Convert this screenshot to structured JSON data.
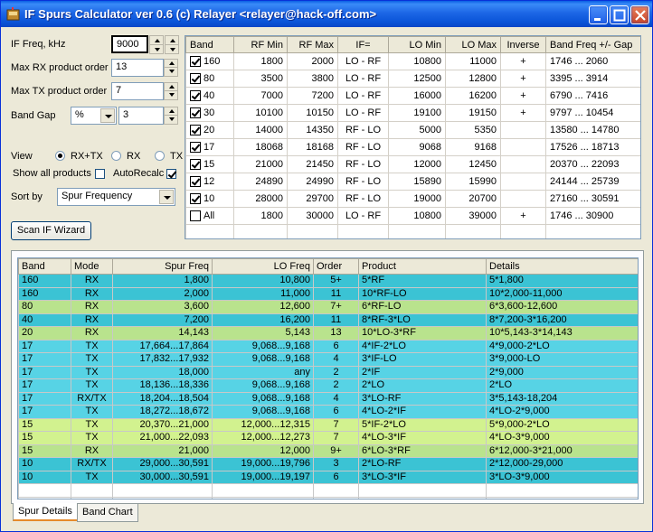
{
  "window": {
    "title": "IF Spurs Calculator ver 0.6 (c) Relayer <relayer@hack-off.com>"
  },
  "form": {
    "if_freq_label": "IF Freq, kHz",
    "if_freq_value": "9000",
    "max_rx_label": "Max RX product order",
    "max_rx_value": "13",
    "max_tx_label": "Max TX product order",
    "max_tx_value": "7",
    "band_gap_label": "Band Gap",
    "band_gap_unit": "%",
    "band_gap_value": "3",
    "view_label": "View",
    "view_options": [
      "RX+TX",
      "RX",
      "TX"
    ],
    "view_selected": "RX+TX",
    "show_all_label": "Show all products",
    "autorecalc_label": "AutoRecalc",
    "show_all_checked": false,
    "autorecalc_checked": true,
    "sort_label": "Sort by",
    "sort_value": "Spur Frequency",
    "scan_button": "Scan IF Wizard"
  },
  "band_table": {
    "headers": [
      "Band",
      "RF Min",
      "RF Max",
      "IF=",
      "LO Min",
      "LO Max",
      "Inverse",
      "Band Freq +/- Gap"
    ],
    "rows": [
      {
        "checked": true,
        "band": "160",
        "rf_min": "1800",
        "rf_max": "2000",
        "if": "LO - RF",
        "lo_min": "10800",
        "lo_max": "11000",
        "inverse": "+",
        "gap": "1746 ... 2060"
      },
      {
        "checked": true,
        "band": "80",
        "rf_min": "3500",
        "rf_max": "3800",
        "if": "LO - RF",
        "lo_min": "12500",
        "lo_max": "12800",
        "inverse": "+",
        "gap": "3395 ... 3914"
      },
      {
        "checked": true,
        "band": "40",
        "rf_min": "7000",
        "rf_max": "7200",
        "if": "LO - RF",
        "lo_min": "16000",
        "lo_max": "16200",
        "inverse": "+",
        "gap": "6790 ... 7416"
      },
      {
        "checked": true,
        "band": "30",
        "rf_min": "10100",
        "rf_max": "10150",
        "if": "LO - RF",
        "lo_min": "19100",
        "lo_max": "19150",
        "inverse": "+",
        "gap": "9797 ... 10454"
      },
      {
        "checked": true,
        "band": "20",
        "rf_min": "14000",
        "rf_max": "14350",
        "if": "RF - LO",
        "lo_min": "5000",
        "lo_max": "5350",
        "inverse": "",
        "gap": "13580 ... 14780"
      },
      {
        "checked": true,
        "band": "17",
        "rf_min": "18068",
        "rf_max": "18168",
        "if": "RF - LO",
        "lo_min": "9068",
        "lo_max": "9168",
        "inverse": "",
        "gap": "17526 ... 18713"
      },
      {
        "checked": true,
        "band": "15",
        "rf_min": "21000",
        "rf_max": "21450",
        "if": "RF - LO",
        "lo_min": "12000",
        "lo_max": "12450",
        "inverse": "",
        "gap": "20370 ... 22093"
      },
      {
        "checked": true,
        "band": "12",
        "rf_min": "24890",
        "rf_max": "24990",
        "if": "RF - LO",
        "lo_min": "15890",
        "lo_max": "15990",
        "inverse": "",
        "gap": "24144 ... 25739"
      },
      {
        "checked": true,
        "band": "10",
        "rf_min": "28000",
        "rf_max": "29700",
        "if": "RF - LO",
        "lo_min": "19000",
        "lo_max": "20700",
        "inverse": "",
        "gap": "27160 ... 30591"
      },
      {
        "checked": false,
        "band": "All",
        "rf_min": "1800",
        "rf_max": "30000",
        "if": "LO - RF",
        "lo_min": "10800",
        "lo_max": "39000",
        "inverse": "+",
        "gap": "1746 ... 30900"
      }
    ]
  },
  "spur_table": {
    "headers": [
      "Band",
      "Mode",
      "Spur Freq",
      "LO Freq",
      "Order",
      "Product",
      "Details"
    ],
    "rows": [
      {
        "color": "#3bc3d4",
        "band": "160",
        "mode": "RX",
        "spur": "1,800",
        "lo": "10,800",
        "order": "5+",
        "product": "5*RF",
        "details": "5*1,800"
      },
      {
        "color": "#3bc3d4",
        "band": "160",
        "mode": "RX",
        "spur": "2,000",
        "lo": "11,000",
        "order": "11",
        "product": "10*RF-LO",
        "details": "10*2,000-11,000"
      },
      {
        "color": "#b9e38d",
        "band": "80",
        "mode": "RX",
        "spur": "3,600",
        "lo": "12,600",
        "order": "7+",
        "product": "6*RF-LO",
        "details": "6*3,600-12,600"
      },
      {
        "color": "#3bc3d4",
        "band": "40",
        "mode": "RX",
        "spur": "7,200",
        "lo": "16,200",
        "order": "11",
        "product": "8*RF-3*LO",
        "details": "8*7,200-3*16,200"
      },
      {
        "color": "#b9e38d",
        "band": "20",
        "mode": "RX",
        "spur": "14,143",
        "lo": "5,143",
        "order": "13",
        "product": "10*LO-3*RF",
        "details": "10*5,143-3*14,143"
      },
      {
        "color": "#57d3e5",
        "band": "17",
        "mode": "TX",
        "spur": "17,664...17,864",
        "lo": "9,068...9,168",
        "order": "6",
        "product": "4*IF-2*LO",
        "details": "4*9,000-2*LO"
      },
      {
        "color": "#57d3e5",
        "band": "17",
        "mode": "TX",
        "spur": "17,832...17,932",
        "lo": "9,068...9,168",
        "order": "4",
        "product": "3*IF-LO",
        "details": "3*9,000-LO"
      },
      {
        "color": "#57d3e5",
        "band": "17",
        "mode": "TX",
        "spur": "18,000",
        "lo": "any",
        "order": "2",
        "product": "2*IF",
        "details": "2*9,000"
      },
      {
        "color": "#57d3e5",
        "band": "17",
        "mode": "TX",
        "spur": "18,136...18,336",
        "lo": "9,068...9,168",
        "order": "2",
        "product": "2*LO",
        "details": "2*LO"
      },
      {
        "color": "#57d3e5",
        "band": "17",
        "mode": "RX/TX",
        "spur": "18,204...18,504",
        "lo": "9,068...9,168",
        "order": "4",
        "product": "3*LO-RF",
        "details": "3*5,143-18,204"
      },
      {
        "color": "#57d3e5",
        "band": "17",
        "mode": "TX",
        "spur": "18,272...18,672",
        "lo": "9,068...9,168",
        "order": "6",
        "product": "4*LO-2*IF",
        "details": "4*LO-2*9,000"
      },
      {
        "color": "#d2f28f",
        "band": "15",
        "mode": "TX",
        "spur": "20,370...21,000",
        "lo": "12,000...12,315",
        "order": "7",
        "product": "5*IF-2*LO",
        "details": "5*9,000-2*LO"
      },
      {
        "color": "#d2f28f",
        "band": "15",
        "mode": "TX",
        "spur": "21,000...22,093",
        "lo": "12,000...12,273",
        "order": "7",
        "product": "4*LO-3*IF",
        "details": "4*LO-3*9,000"
      },
      {
        "color": "#b9e38d",
        "band": "15",
        "mode": "RX",
        "spur": "21,000",
        "lo": "12,000",
        "order": "9+",
        "product": "6*LO-3*RF",
        "details": "6*12,000-3*21,000"
      },
      {
        "color": "#3bc3d4",
        "band": "10",
        "mode": "RX/TX",
        "spur": "29,000...30,591",
        "lo": "19,000...19,796",
        "order": "3",
        "product": "2*LO-RF",
        "details": "2*12,000-29,000"
      },
      {
        "color": "#3bc3d4",
        "band": "10",
        "mode": "TX",
        "spur": "30,000...30,591",
        "lo": "19,000...19,197",
        "order": "6",
        "product": "3*LO-3*IF",
        "details": "3*LO-3*9,000"
      }
    ]
  },
  "tabs": [
    "Spur Details",
    "Band Chart"
  ],
  "tab_selected": "Spur Details"
}
